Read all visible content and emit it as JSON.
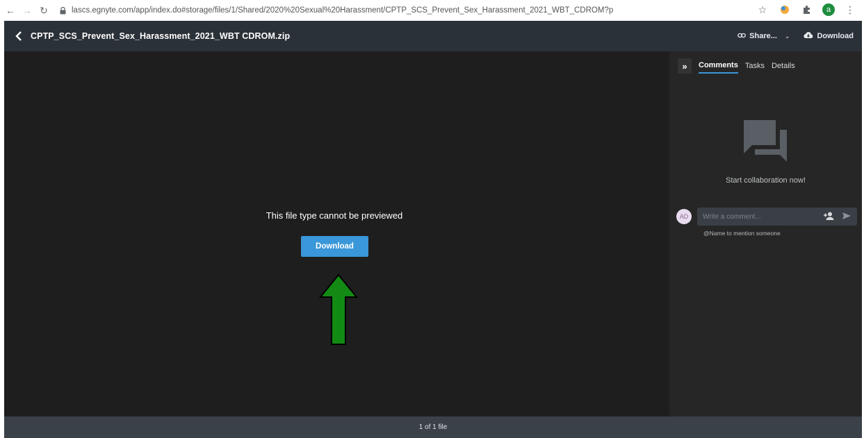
{
  "browser": {
    "url": "lascs.egnyte.com/app/index.do#storage/files/1/Shared/2020%20Sexual%20Harassment/CPTP_SCS_Prevent_Sex_Harassment_2021_WBT_CDROM?p",
    "profile_initial": "a"
  },
  "header": {
    "file_name": "CPTP_SCS_Prevent_Sex_Harassment_2021_WBT CDROM.zip",
    "share_label": "Share...",
    "download_label": "Download"
  },
  "viewer": {
    "message": "This file type cannot be previewed",
    "download_button": "Download"
  },
  "panel": {
    "collapse_symbol": "»",
    "tabs": [
      {
        "label": "Comments",
        "active": true
      },
      {
        "label": "Tasks",
        "active": false
      },
      {
        "label": "Details",
        "active": false
      }
    ],
    "empty_message": "Start collaboration now!",
    "avatar_initials": "AD",
    "comment_placeholder": "Write a comment...",
    "mention_hint": "@Name to mention someone"
  },
  "footer": {
    "file_count": "1 of 1 file"
  },
  "colors": {
    "accent": "#3a97d9",
    "header_bg": "#2b3139",
    "viewer_bg": "#1e1e1e",
    "panel_bg": "#262626",
    "annotation_arrow": "#138a13"
  }
}
